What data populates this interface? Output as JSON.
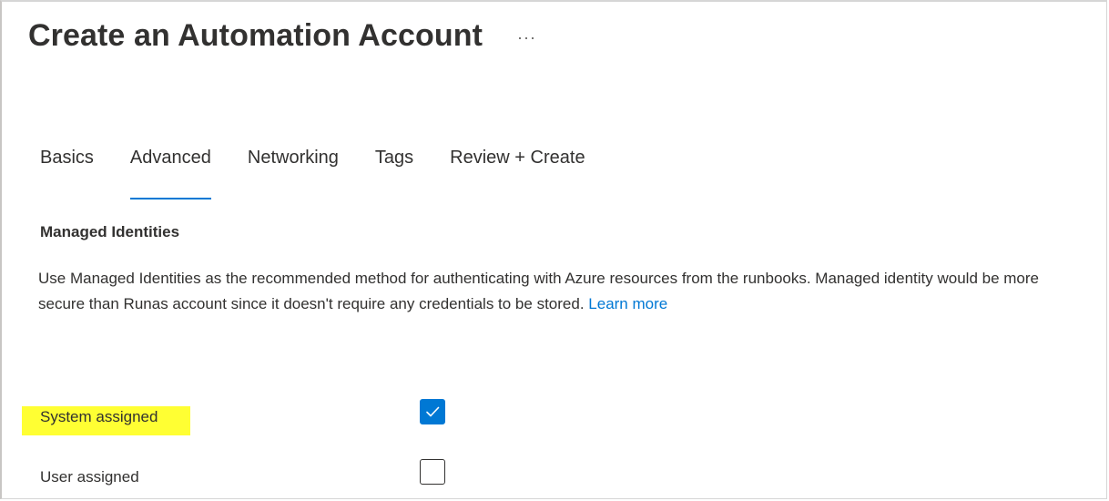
{
  "header": {
    "title": "Create an Automation Account",
    "more_label": "···"
  },
  "tabs": [
    {
      "label": "Basics",
      "active": false
    },
    {
      "label": "Advanced",
      "active": true
    },
    {
      "label": "Networking",
      "active": false
    },
    {
      "label": "Tags",
      "active": false
    },
    {
      "label": "Review + Create",
      "active": false
    }
  ],
  "section": {
    "heading": "Managed Identities",
    "description": "Use Managed Identities as the recommended method for authenticating with Azure resources from the runbooks. Managed identity would be more secure than Runas account since it doesn't require any credentials to be stored.",
    "learn_more": "Learn more"
  },
  "options": [
    {
      "label": "System assigned",
      "checked": true,
      "highlighted": true
    },
    {
      "label": "User assigned",
      "checked": false,
      "highlighted": false
    }
  ],
  "colors": {
    "accent": "#0078d4",
    "highlight": "#ffff33",
    "text": "#323130"
  },
  "icons": {
    "more": "more-horizontal-icon",
    "check": "checkmark-icon"
  }
}
